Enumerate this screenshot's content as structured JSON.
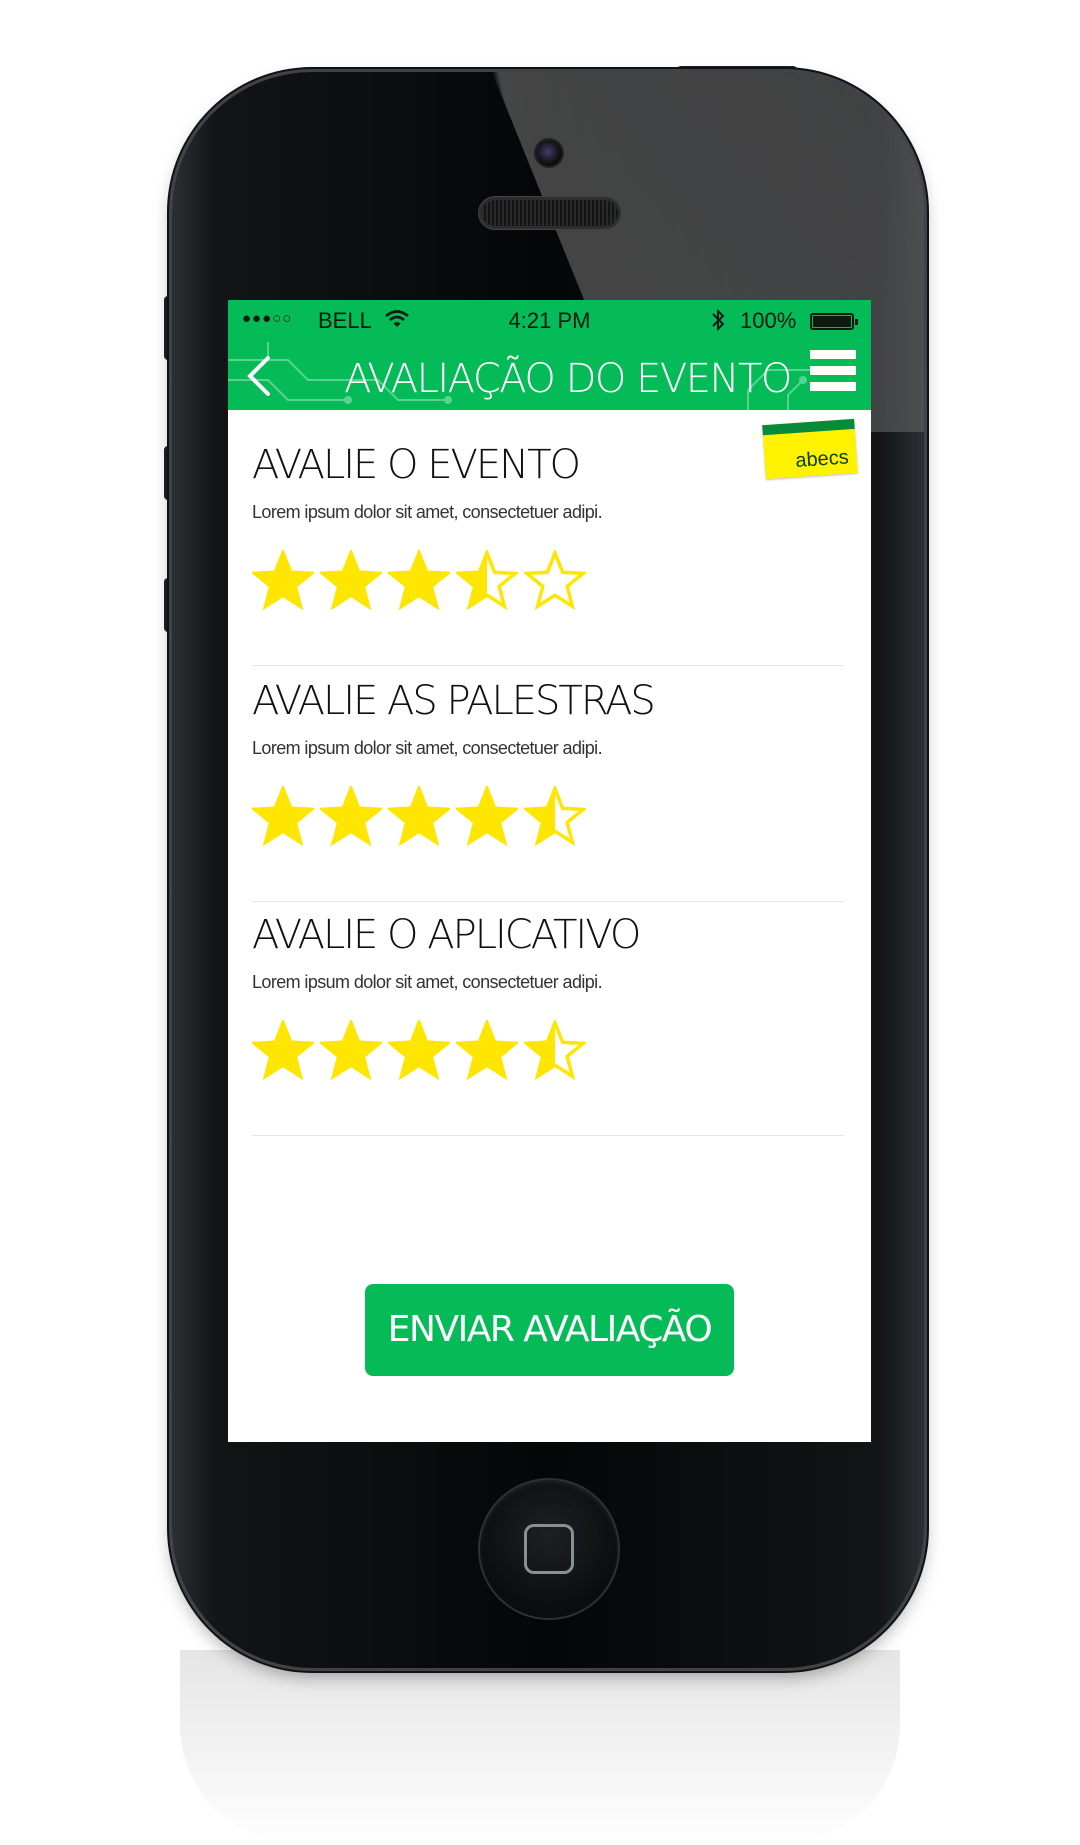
{
  "status_bar": {
    "signal": "●●●○○",
    "carrier": "BELL",
    "time": "4:21 PM",
    "battery": "100%"
  },
  "header": {
    "title": "AVALIAÇÃO DO EVENTO",
    "back_icon": "chevron-left-icon",
    "menu_icon": "hamburger-menu-icon"
  },
  "logo": {
    "text": "abecs"
  },
  "sections": [
    {
      "title": "AVALIE O EVENTO",
      "description": "Lorem ipsum dolor sit amet, consectetuer adipi.",
      "rating": 3.5,
      "max": 5
    },
    {
      "title": "AVALIE AS PALESTRAS",
      "description": "Lorem ipsum dolor sit amet, consectetuer adipi.",
      "rating": 4.5,
      "max": 5
    },
    {
      "title": "AVALIE O APLICATIVO",
      "description": "Lorem ipsum dolor sit amet, consectetuer adipi.",
      "rating": 4.5,
      "max": 5
    }
  ],
  "submit": {
    "label": "ENVIAR AVALIAÇÃO"
  },
  "colors": {
    "accent": "#04bb58",
    "star": "#ffe600",
    "logo_yellow": "#fff200",
    "logo_green": "#078a3a"
  }
}
